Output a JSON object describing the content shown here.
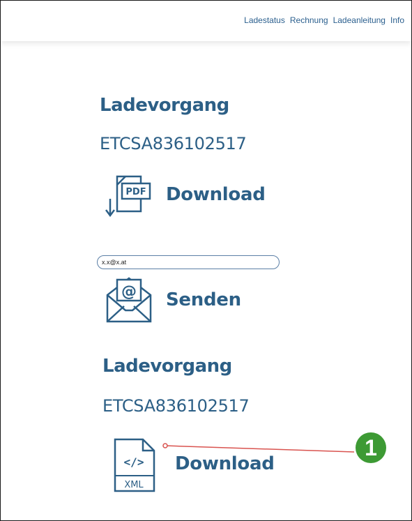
{
  "nav": {
    "items": [
      "Ladestatus",
      "Rechnung",
      "Ladeanleitung",
      "Info"
    ]
  },
  "section1": {
    "heading": "Ladevorgang",
    "session_id": "ETCSA836102517",
    "download_label": "Download",
    "pdf_icon_text": "PDF"
  },
  "email": {
    "value": "x.x@x.at",
    "send_label": "Senden"
  },
  "section2": {
    "heading": "Ladevorgang",
    "session_id": "ETCSA836102517",
    "download_label": "Download",
    "xml_icon_text": "XML",
    "xml_code_text": "</>"
  },
  "annotation": {
    "number": "1",
    "line_color": "#d9534f",
    "badge_color": "#3d9a34"
  },
  "colors": {
    "accent": "#2c5f86"
  }
}
